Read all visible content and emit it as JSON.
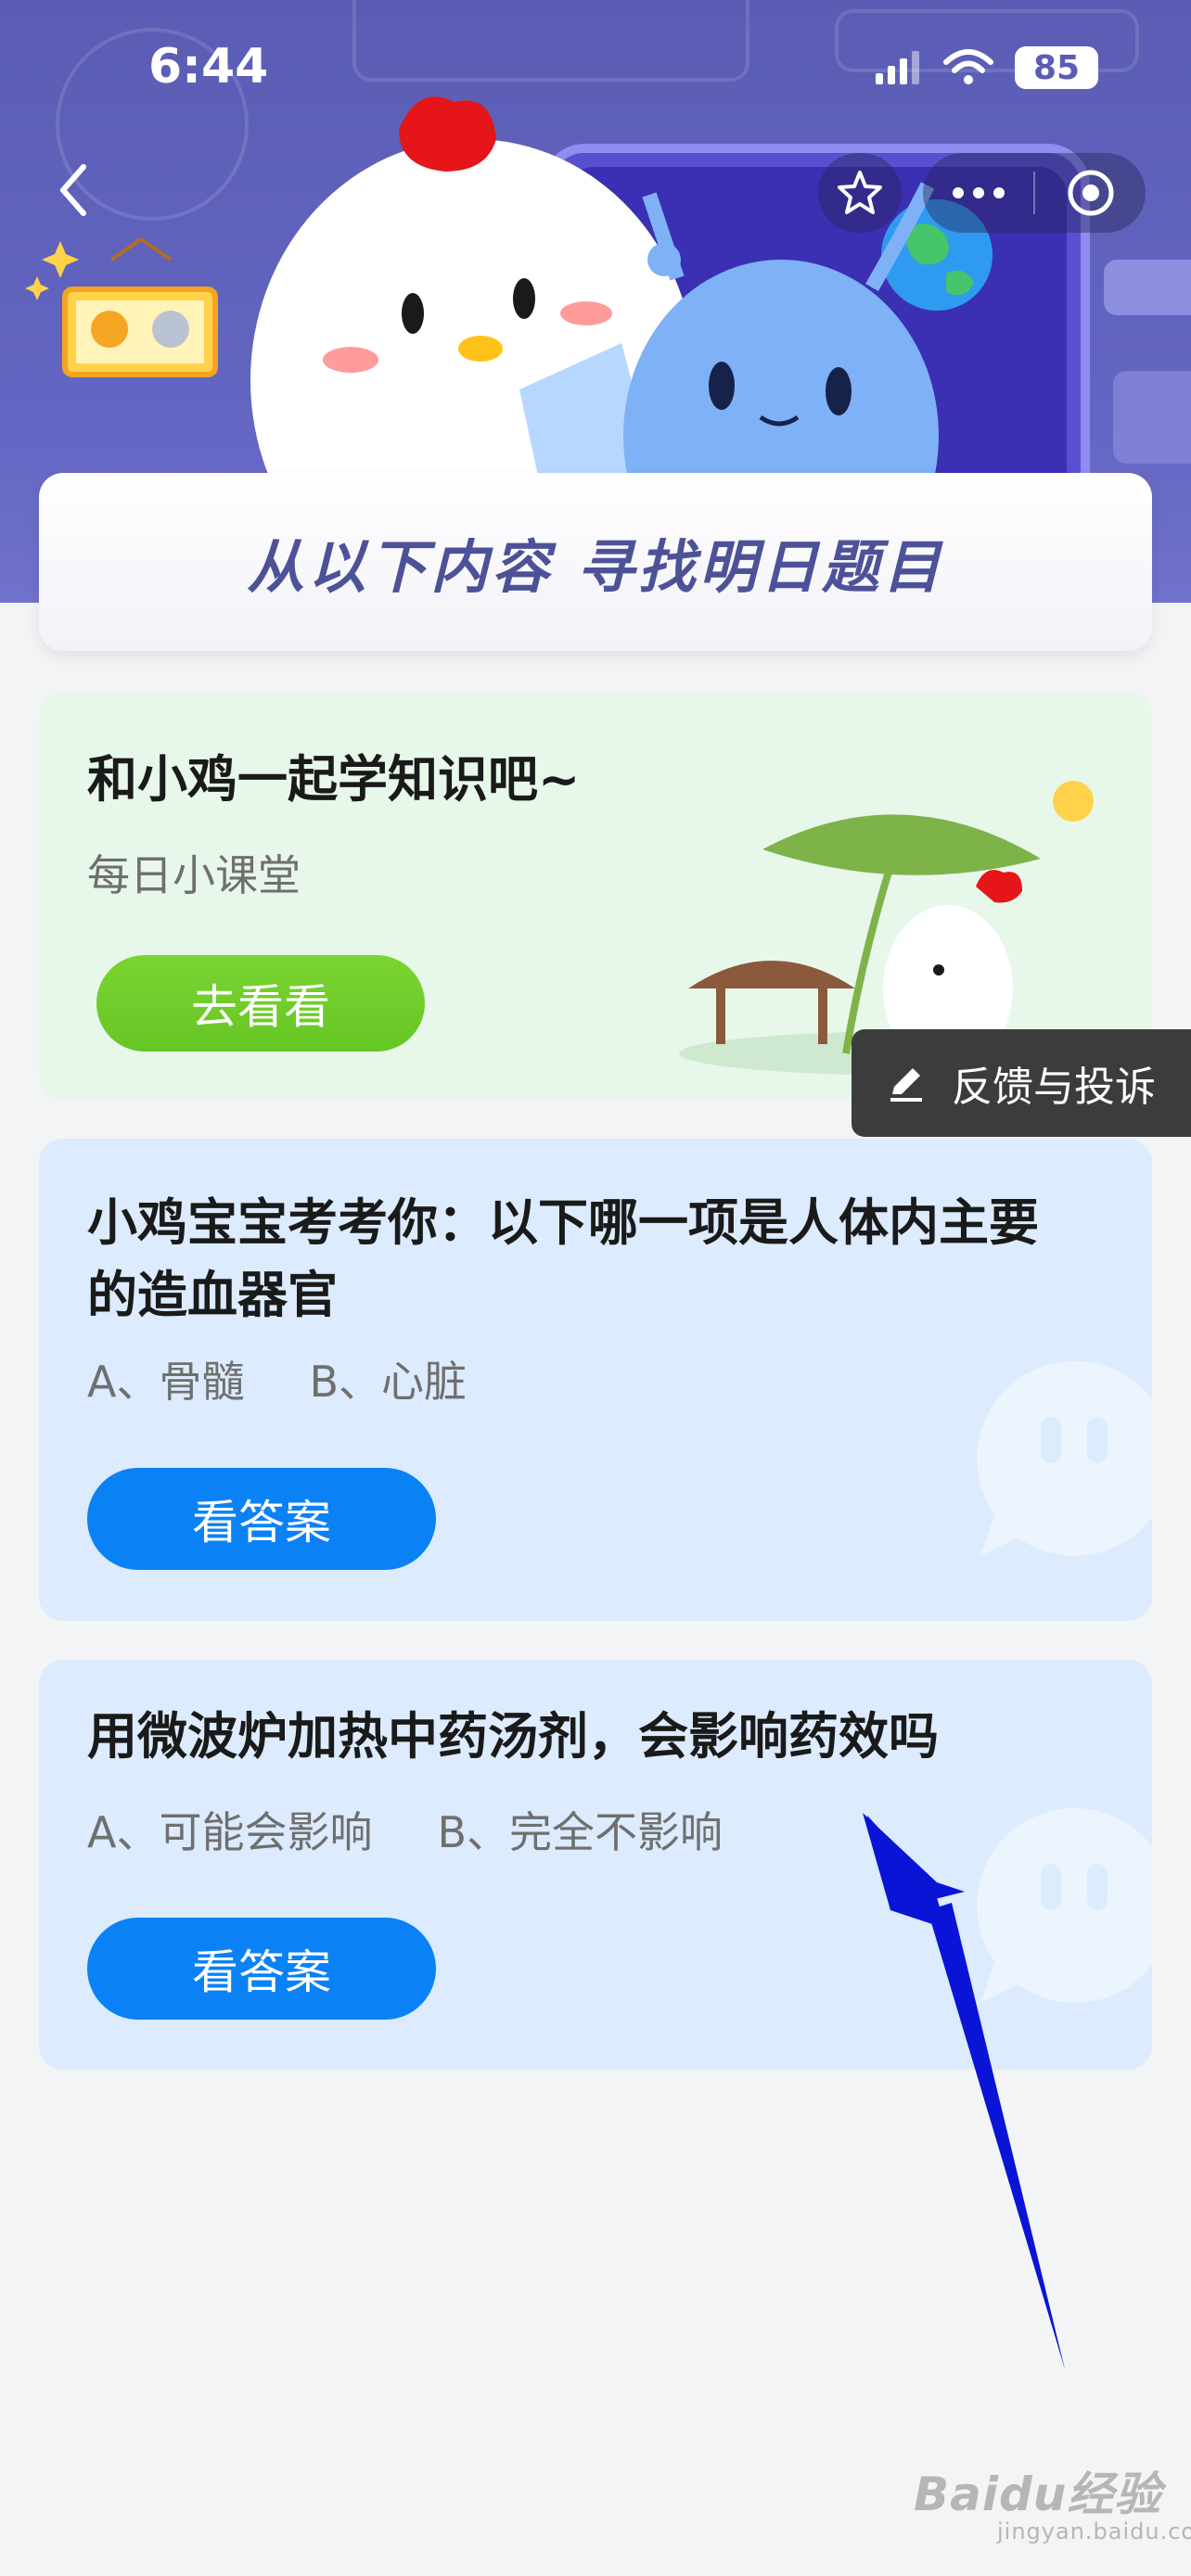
{
  "statusbar": {
    "time": "6:44",
    "battery": "85"
  },
  "banner": {
    "title": "从以下内容  寻找明日题目"
  },
  "cards": [
    {
      "title": "和小鸡一起学知识吧~",
      "subtitle": "每日小课堂",
      "button": "去看看"
    },
    {
      "title": "小鸡宝宝考考你：以下哪一项是人体内主要的造血器官",
      "options": [
        "A、骨髓",
        "B、心脏"
      ],
      "button": "看答案"
    },
    {
      "title": "用微波炉加热中药汤剂，会影响药效吗",
      "options": [
        "A、可能会影响",
        "B、完全不影响"
      ],
      "button": "看答案"
    }
  ],
  "feedback": {
    "label": "反馈与投诉"
  },
  "watermark": {
    "brand": "Baidu经验",
    "domain": "jingyan.baidu.com"
  },
  "colors": {
    "header": "#5b5db4",
    "accent_blue": "#0a82f5",
    "accent_green": "#6ccb2a",
    "arrow": "#0a14d6"
  }
}
